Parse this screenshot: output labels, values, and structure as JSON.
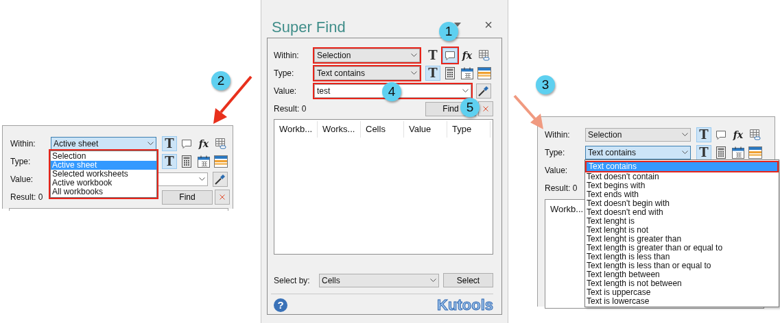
{
  "left_panel": {
    "within": {
      "label": "Within:",
      "value": "Active sheet",
      "open": true,
      "list_highlighted": true,
      "options": [
        {
          "label": "Selection",
          "selected": false
        },
        {
          "label": "Active sheet",
          "selected": true
        },
        {
          "label": "Selected worksheets",
          "selected": false
        },
        {
          "label": "Active workbook",
          "selected": false
        },
        {
          "label": "All workbooks",
          "selected": false
        }
      ]
    },
    "scope_icons": [
      {
        "kind": "text",
        "glyph": "T",
        "selected": true
      },
      {
        "kind": "comment",
        "selected": false
      },
      {
        "kind": "formula",
        "glyph": "fx",
        "selected": false
      },
      {
        "kind": "hyperlink",
        "selected": false
      }
    ],
    "type": {
      "label": "Type:"
    },
    "type_icons": [
      {
        "kind": "text",
        "glyph": "T",
        "selected": true
      },
      {
        "kind": "number",
        "selected": false
      },
      {
        "kind": "date",
        "selected": false
      },
      {
        "kind": "format",
        "selected": false
      }
    ],
    "value": {
      "label": "Value:",
      "kind": "combo"
    },
    "result": "Result: 0",
    "find_button": "Find"
  },
  "center_panel": {
    "title": "Super Find",
    "close": "×",
    "within": {
      "label": "Within:",
      "value": "Selection",
      "highlighted": true
    },
    "scope_icons": [
      {
        "kind": "text",
        "glyph": "T",
        "selected": false
      },
      {
        "kind": "comment",
        "selected": true,
        "highlighted": true
      },
      {
        "kind": "formula",
        "glyph": "fx",
        "selected": false
      },
      {
        "kind": "hyperlink",
        "selected": false
      }
    ],
    "type": {
      "label": "Type:",
      "value": "Text contains",
      "highlighted": true
    },
    "type_icons": [
      {
        "kind": "text",
        "glyph": "T",
        "selected": true
      },
      {
        "kind": "number",
        "selected": false
      },
      {
        "kind": "date",
        "selected": false
      },
      {
        "kind": "format",
        "selected": false
      }
    ],
    "value": {
      "label": "Value:",
      "kind": "combo",
      "text": "test",
      "highlighted": true
    },
    "result": "Result: 0",
    "find_button": "Find",
    "columns": [
      "Workb...",
      "Works...",
      "Cells",
      "Value",
      "Type"
    ],
    "select_by": {
      "label": "Select by:",
      "value": "Cells"
    },
    "select_button": "Select",
    "help": "?",
    "brand": "Kutools"
  },
  "right_panel": {
    "within": {
      "label": "Within:",
      "value": "Selection"
    },
    "scope_icons": [
      {
        "kind": "text",
        "glyph": "T",
        "selected": true
      },
      {
        "kind": "comment",
        "selected": false
      },
      {
        "kind": "formula",
        "glyph": "fx",
        "selected": false
      },
      {
        "kind": "hyperlink",
        "selected": false
      }
    ],
    "type": {
      "label": "Type:",
      "value": "Text contains",
      "open": true,
      "options": [
        {
          "label": "Text contains",
          "selected": true,
          "highlighted": true
        },
        {
          "label": "Text doesn't contain",
          "selected": false
        },
        {
          "label": "Text begins with",
          "selected": false
        },
        {
          "label": "Text ends with",
          "selected": false
        },
        {
          "label": "Text doesn't begin with",
          "selected": false
        },
        {
          "label": "Text doesn't end with",
          "selected": false
        },
        {
          "label": "Text lenght is",
          "selected": false
        },
        {
          "label": "Text lenght is not",
          "selected": false
        },
        {
          "label": "Text lenght is greater than",
          "selected": false
        },
        {
          "label": "Text length is greater than or equal to",
          "selected": false
        },
        {
          "label": "Text length is less than",
          "selected": false
        },
        {
          "label": "Text length is less than or equal to",
          "selected": false
        },
        {
          "label": "Text length between",
          "selected": false
        },
        {
          "label": "Text length is not between",
          "selected": false
        },
        {
          "label": "Text is uppercase",
          "selected": false
        },
        {
          "label": "Text is lowercase",
          "selected": false
        }
      ]
    },
    "type_icons": [
      {
        "kind": "text",
        "glyph": "T",
        "selected": true
      },
      {
        "kind": "number",
        "selected": false
      },
      {
        "kind": "date",
        "selected": false
      },
      {
        "kind": "format",
        "selected": false
      }
    ],
    "value": {
      "label": "Value:"
    },
    "result": "Result: 0",
    "columns": [
      "Workb..."
    ]
  },
  "callouts": [
    {
      "number": "1"
    },
    {
      "number": "2"
    },
    {
      "number": "3"
    },
    {
      "number": "4"
    },
    {
      "number": "5"
    }
  ]
}
